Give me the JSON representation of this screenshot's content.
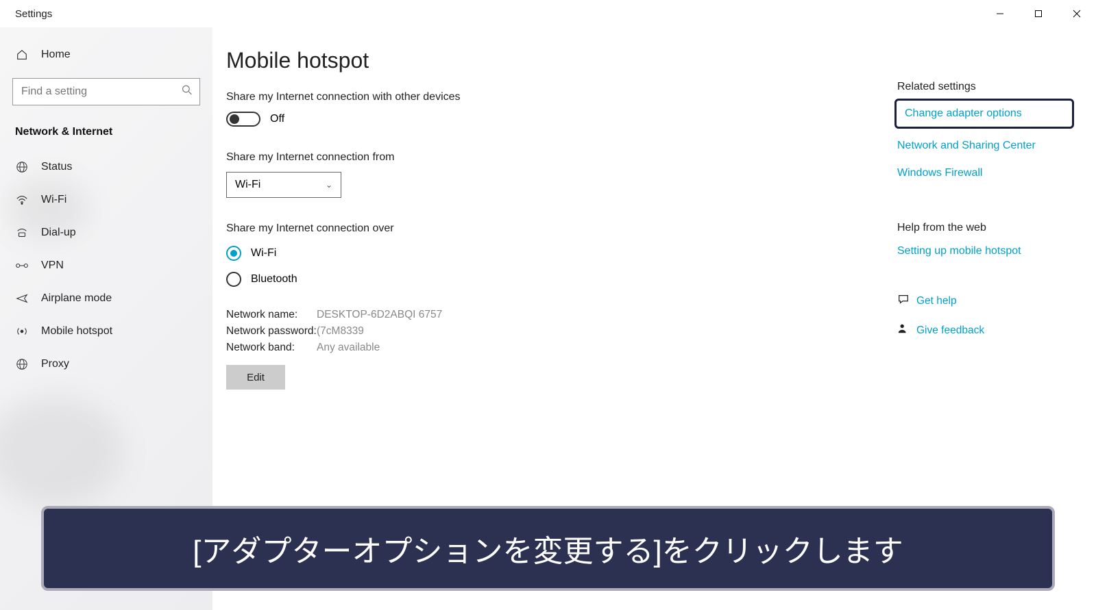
{
  "window": {
    "title": "Settings"
  },
  "sidebar": {
    "home": "Home",
    "search_placeholder": "Find a setting",
    "section": "Network & Internet",
    "items": [
      {
        "label": "Status"
      },
      {
        "label": "Wi-Fi"
      },
      {
        "label": "Dial-up"
      },
      {
        "label": "VPN"
      },
      {
        "label": "Airplane mode"
      },
      {
        "label": "Mobile hotspot"
      },
      {
        "label": "Proxy"
      }
    ]
  },
  "main": {
    "title": "Mobile hotspot",
    "share_with_devices": "Share my Internet connection with other devices",
    "toggle_state": "Off",
    "share_from": "Share my Internet connection from",
    "share_from_value": "Wi-Fi",
    "share_over": "Share my Internet connection over",
    "radio_wifi": "Wi-Fi",
    "radio_bt": "Bluetooth",
    "net_name_label": "Network name:",
    "net_name_value": "DESKTOP-6D2ABQI 6757",
    "net_pass_label": "Network password:",
    "net_pass_value": "(7cM8339",
    "net_band_label": "Network band:",
    "net_band_value": "Any available",
    "edit": "Edit"
  },
  "aside": {
    "related_heading": "Related settings",
    "link_adapter": "Change adapter options",
    "link_sharing": "Network and Sharing Center",
    "link_firewall": "Windows Firewall",
    "help_heading": "Help from the web",
    "link_setup": "Setting up mobile hotspot",
    "get_help": "Get help",
    "feedback": "Give feedback"
  },
  "caption": "[アダプターオプションを変更する]をクリックします"
}
